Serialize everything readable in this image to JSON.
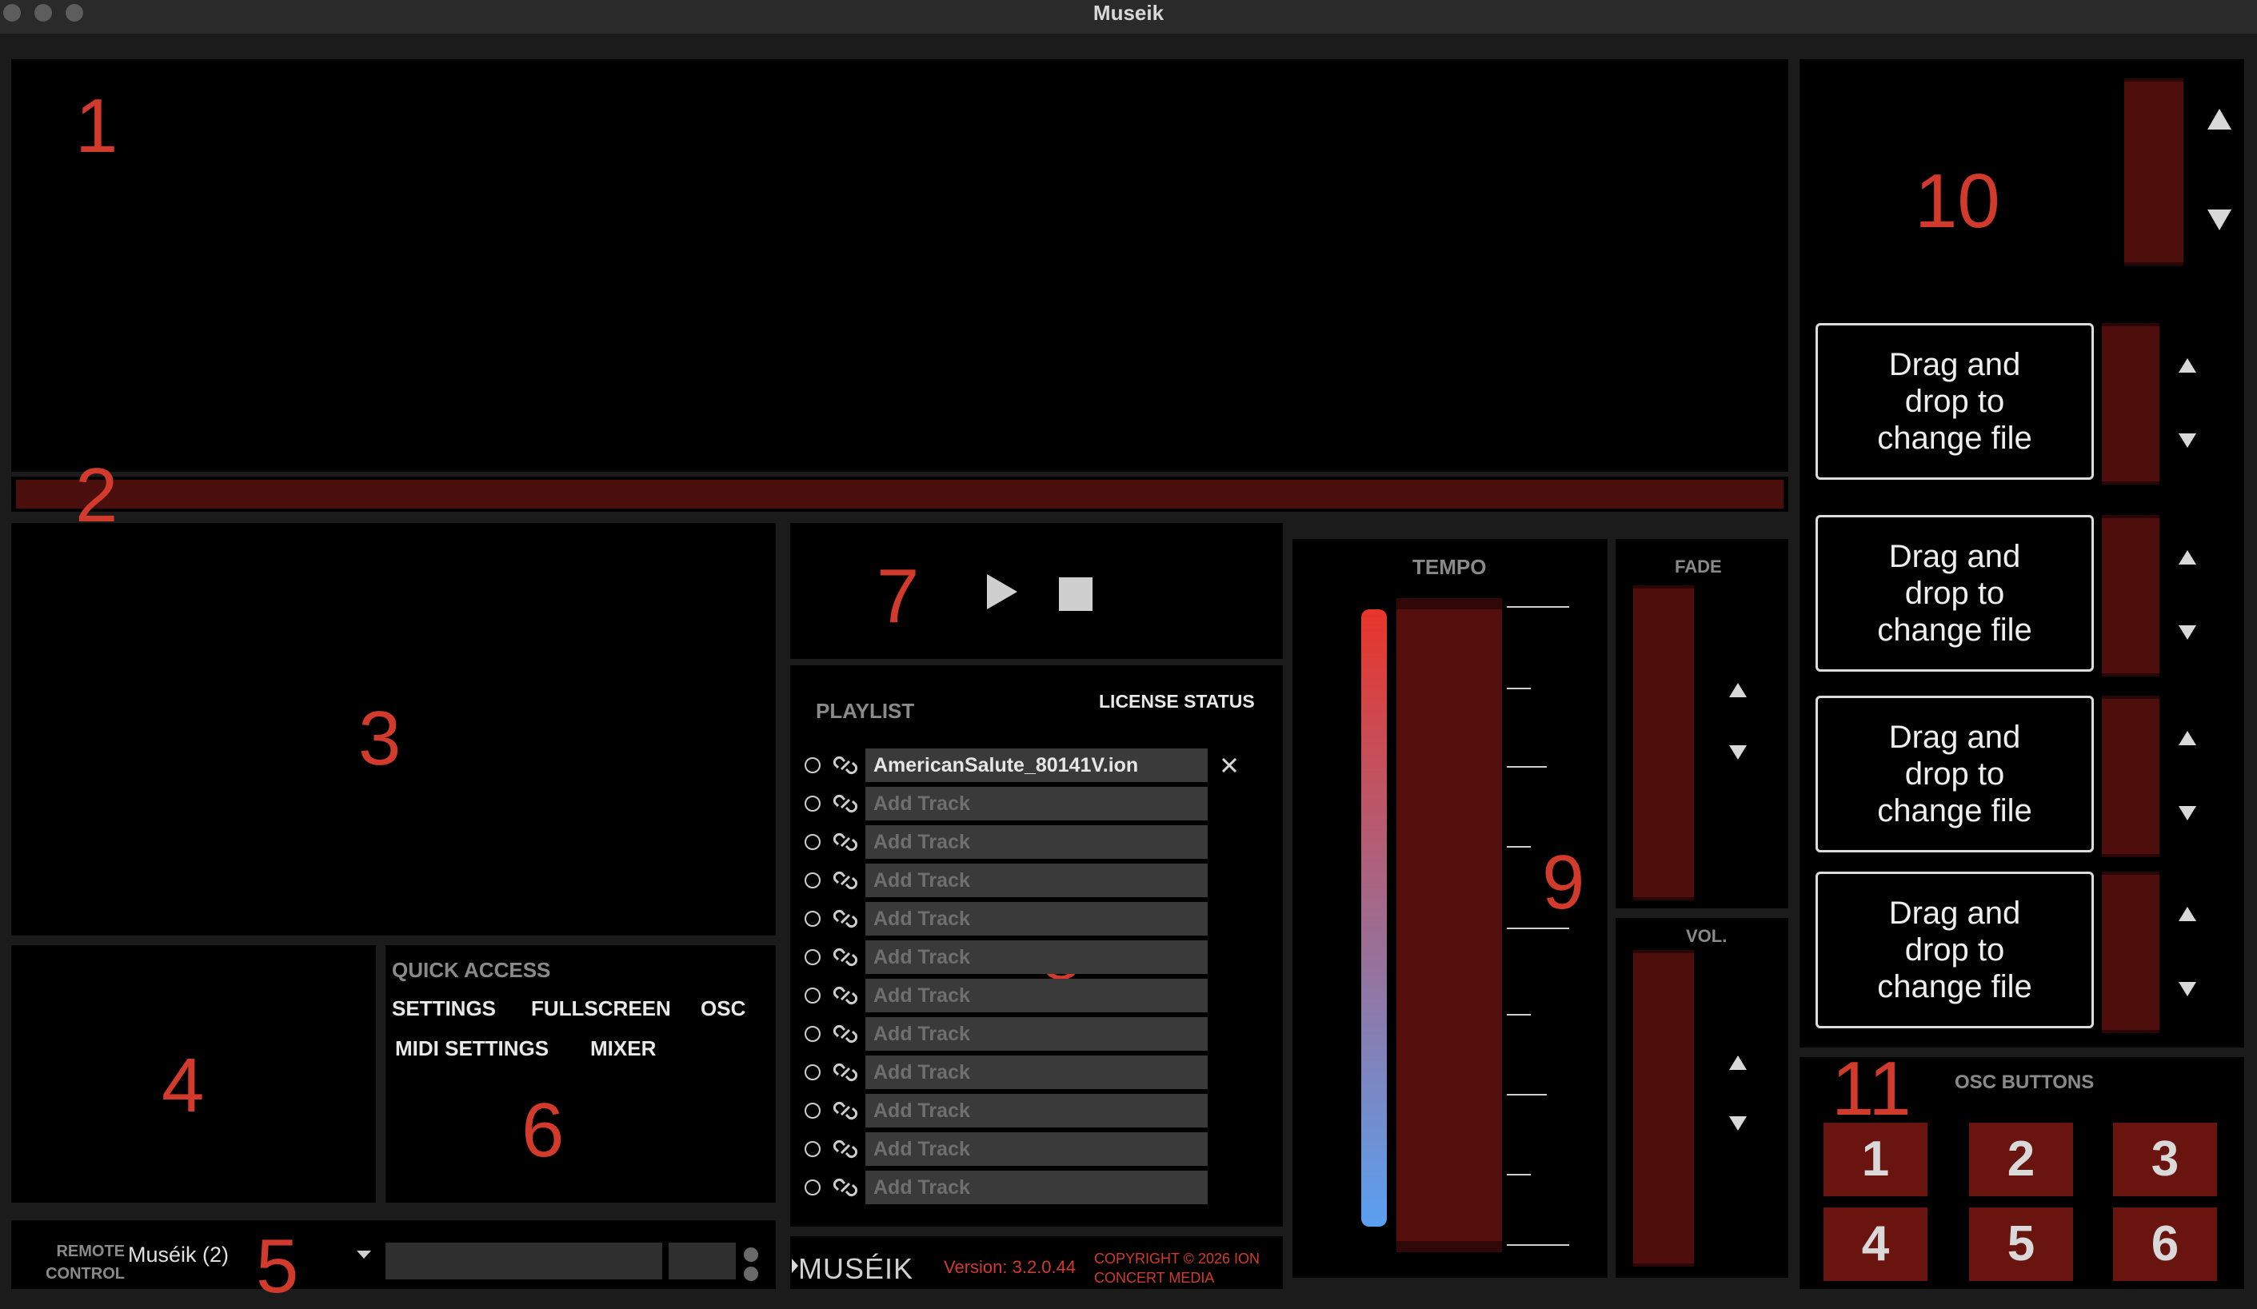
{
  "window": {
    "title": "Museik"
  },
  "section_numbers": [
    "1",
    "2",
    "3",
    "4",
    "5",
    "6",
    "7",
    "8",
    "9",
    "10",
    "11"
  ],
  "transport": {
    "play_icon": "play-icon",
    "stop_icon": "stop-icon"
  },
  "playlist": {
    "header": "PLAYLIST",
    "license_status": "LICENSE STATUS",
    "tracks": [
      "AmericanSalute_80141V.ion",
      "Add Track",
      "Add Track",
      "Add Track",
      "Add Track",
      "Add Track",
      "Add Track",
      "Add Track",
      "Add Track",
      "Add Track",
      "Add Track",
      "Add Track"
    ]
  },
  "quick_access": {
    "header": "QUICK ACCESS",
    "buttons": [
      "SETTINGS",
      "FULLSCREEN",
      "OSC",
      "MIDI SETTINGS",
      "MIXER"
    ]
  },
  "remote_control": {
    "label_line1": "REMOTE",
    "label_line2": "CONTROL",
    "selected": "Muséik (2)"
  },
  "footer": {
    "logo": "MUSÉIK",
    "version": "Version: 3.2.0.44",
    "copyright_line1": "COPYRIGHT © 2026 ION",
    "copyright_line2": "CONCERT MEDIA"
  },
  "tempo": {
    "label": "TEMPO"
  },
  "fade": {
    "label": "FADE"
  },
  "vol": {
    "label": "VOL."
  },
  "drop_zones": [
    "Drag and drop to change file",
    "Drag and drop to change file",
    "Drag and drop to change file",
    "Drag and drop to change file"
  ],
  "osc": {
    "header": "OSC BUTTONS",
    "buttons": [
      "1",
      "2",
      "3",
      "4",
      "5",
      "6"
    ]
  },
  "colors": {
    "accent_red": "#d23a2c",
    "slider_red": "#4d0e0c",
    "osc_button": "#6a1410",
    "gradient_top": "#e8352a",
    "gradient_bottom": "#5aa0f0"
  }
}
